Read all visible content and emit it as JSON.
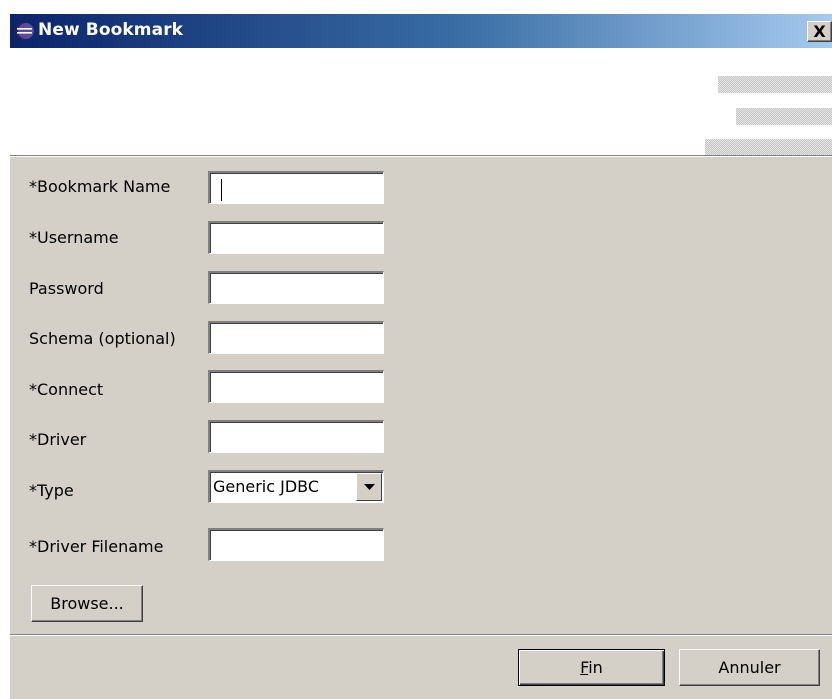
{
  "window": {
    "title": "New Bookmark",
    "close_label": "X"
  },
  "form": {
    "bookmark_name": {
      "label": "*Bookmark Name",
      "value": ""
    },
    "username": {
      "label": "*Username",
      "value": ""
    },
    "password": {
      "label": "Password",
      "value": ""
    },
    "schema": {
      "label": "Schema (optional)",
      "value": ""
    },
    "connect": {
      "label": "*Connect",
      "value": ""
    },
    "driver": {
      "label": "*Driver",
      "value": ""
    },
    "type": {
      "label": "*Type",
      "selected": "Generic JDBC"
    },
    "driver_filename": {
      "label": "*Driver Filename",
      "value": ""
    },
    "browse_label": "Browse..."
  },
  "footer": {
    "finish_mnemonic": "F",
    "finish_rest": "in",
    "cancel_label": "Annuler"
  },
  "colors": {
    "titlebar_start": "#0a246a",
    "titlebar_end": "#a6caf0",
    "dialog_face": "#d4d0c8",
    "banner_background": "#ffffff"
  },
  "icons": {
    "title_icon": "eclipse-icon",
    "close_icon": "close-icon",
    "dropdown_icon": "dropdown-arrow-icon"
  }
}
